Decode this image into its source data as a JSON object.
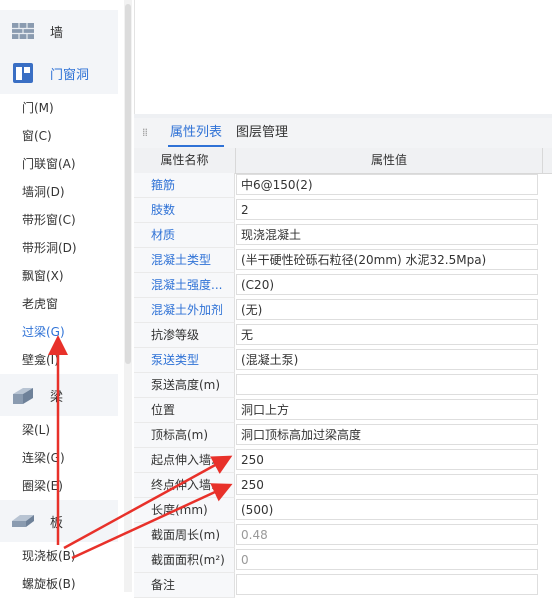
{
  "nav": {
    "wall": {
      "label": "墙",
      "icon": "wall-icon"
    },
    "door_window": {
      "label": "门窗洞",
      "icon": "door-window-icon"
    },
    "door_items": [
      "门(M)",
      "窗(C)",
      "门联窗(A)",
      "墙洞(D)",
      "带形窗(C)",
      "带形洞(D)",
      "飘窗(X)",
      "老虎窗",
      "过梁(G)",
      "壁龛(I)"
    ],
    "beam": {
      "label": "梁",
      "icon": "beam-icon"
    },
    "beam_items": [
      "梁(L)",
      "连梁(G)",
      "圈梁(E)"
    ],
    "slab": {
      "label": "板",
      "icon": "slab-icon"
    },
    "slab_items": [
      "现浇板(B)",
      "螺旋板(B)"
    ]
  },
  "props": {
    "tabs": [
      "属性列表",
      "图层管理"
    ],
    "col_name": "属性名称",
    "col_value": "属性值",
    "rows": [
      {
        "name": "箍筋",
        "value": "中6@150(2)",
        "link": true
      },
      {
        "name": "肢数",
        "value": "2",
        "link": true
      },
      {
        "name": "材质",
        "value": "现浇混凝土",
        "link": true
      },
      {
        "name": "混凝土类型",
        "value": "(半干硬性砼砾石粒径(20mm) 水泥32.5Mpa)",
        "link": true
      },
      {
        "name": "混凝土强度...",
        "value": "(C20)",
        "link": true
      },
      {
        "name": "混凝土外加剂",
        "value": "(无)",
        "link": true
      },
      {
        "name": "抗渗等级",
        "value": "无",
        "link": false
      },
      {
        "name": "泵送类型",
        "value": "(混凝土泵)",
        "link": true
      },
      {
        "name": "泵送高度(m)",
        "value": "",
        "link": false
      },
      {
        "name": "位置",
        "value": "洞口上方",
        "link": false
      },
      {
        "name": "顶标高(m)",
        "value": "洞口顶标高加过梁高度",
        "link": false
      },
      {
        "name": "起点伸入墙...",
        "value": "250",
        "link": false
      },
      {
        "name": "终点伸入墙...",
        "value": "250",
        "link": false
      },
      {
        "name": "长度(mm)",
        "value": "(500)",
        "link": false
      },
      {
        "name": "截面周长(m)",
        "value": "0.48",
        "link": false,
        "readonly": true
      },
      {
        "name": "截面面积(m²)",
        "value": "0",
        "link": false,
        "readonly": true
      },
      {
        "name": "备注",
        "value": "",
        "link": false
      }
    ]
  },
  "colors": {
    "accent": "#2f72d6",
    "arrow": "#e8312a"
  }
}
